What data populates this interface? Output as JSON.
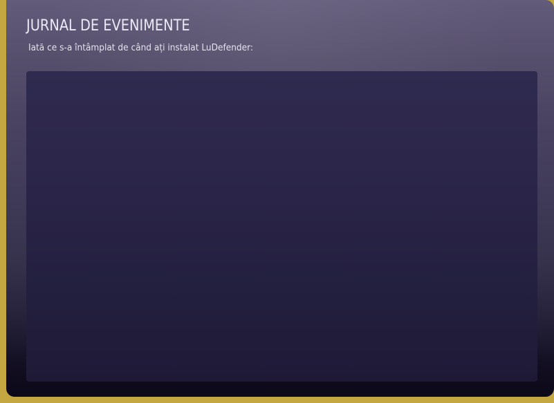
{
  "event_log": {
    "title": "JURNAL DE EVENIMENTE",
    "subtitle": "Iată ce s-a întâmplat de când ați instalat LuDefender:",
    "entries": []
  },
  "colors": {
    "accent_border": "#c4a740",
    "panel_background": "#2a2548",
    "title_text": "#ece8f6"
  }
}
